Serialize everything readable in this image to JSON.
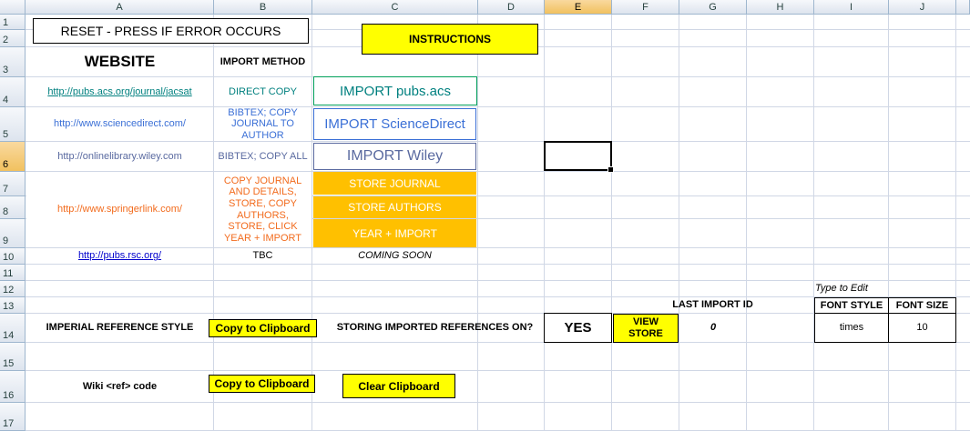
{
  "columns": [
    "A",
    "B",
    "C",
    "D",
    "E",
    "F",
    "G",
    "H",
    "I",
    "J"
  ],
  "rows": [
    "1",
    "2",
    "3",
    "4",
    "5",
    "6",
    "7",
    "8",
    "9",
    "10",
    "11",
    "12",
    "13",
    "14",
    "15",
    "16",
    "17"
  ],
  "selected_column": "E",
  "selected_row": "6",
  "reset_button": "RESET  - PRESS IF ERROR OCCURS",
  "instructions_button": "INSTRUCTIONS",
  "headers": {
    "website": "WEBSITE",
    "import_method": "IMPORT METHOD"
  },
  "sites": [
    {
      "url": "http://pubs.acs.org/journal/jacsat",
      "method": "DIRECT COPY",
      "button": "IMPORT pubs.acs",
      "color": "#00807f"
    },
    {
      "url": "http://www.sciencedirect.com/",
      "method": "BIBTEX; COPY JOURNAL TO AUTHOR",
      "button": "IMPORT ScienceDirect",
      "color": "#3a6fd6"
    },
    {
      "url": "http://onlinelibrary.wiley.com",
      "method": "BIBTEX; COPY ALL",
      "button": "IMPORT Wiley",
      "color": "#5a6aa0"
    },
    {
      "url": "http://www.springerlink.com/",
      "method": "COPY JOURNAL AND DETAILS, STORE, COPY AUTHORS, STORE, CLICK YEAR + IMPORT",
      "color": "#f26b1d"
    },
    {
      "url": "http://pubs.rsc.org/",
      "method": "TBC",
      "status": "COMING SOON"
    }
  ],
  "springer_buttons": [
    "STORE JOURNAL",
    "STORE AUTHORS",
    "YEAR + IMPORT"
  ],
  "type_to_edit": "Type to Edit",
  "font_style_label": "FONT STYLE",
  "font_size_label": "FONT SIZE",
  "font_style_value": "times",
  "font_size_value": "10",
  "last_import_label": "LAST IMPORT ID",
  "last_import_value": "0",
  "imperial_label": "IMPERIAL REFERENCE STYLE",
  "copy_clipboard_label": "Copy to Clipboard",
  "storing_label": "STORING IMPORTED REFERENCES ON?",
  "storing_value": "YES",
  "view_store_label": "VIEW STORE",
  "wiki_label": "Wiki <ref> code",
  "clear_clipboard_label": "Clear Clipboard",
  "colors": {
    "yellow": "#ffff00",
    "orange": "#ffc000",
    "grid": "#d0d7e5",
    "link": "#0000cc"
  }
}
